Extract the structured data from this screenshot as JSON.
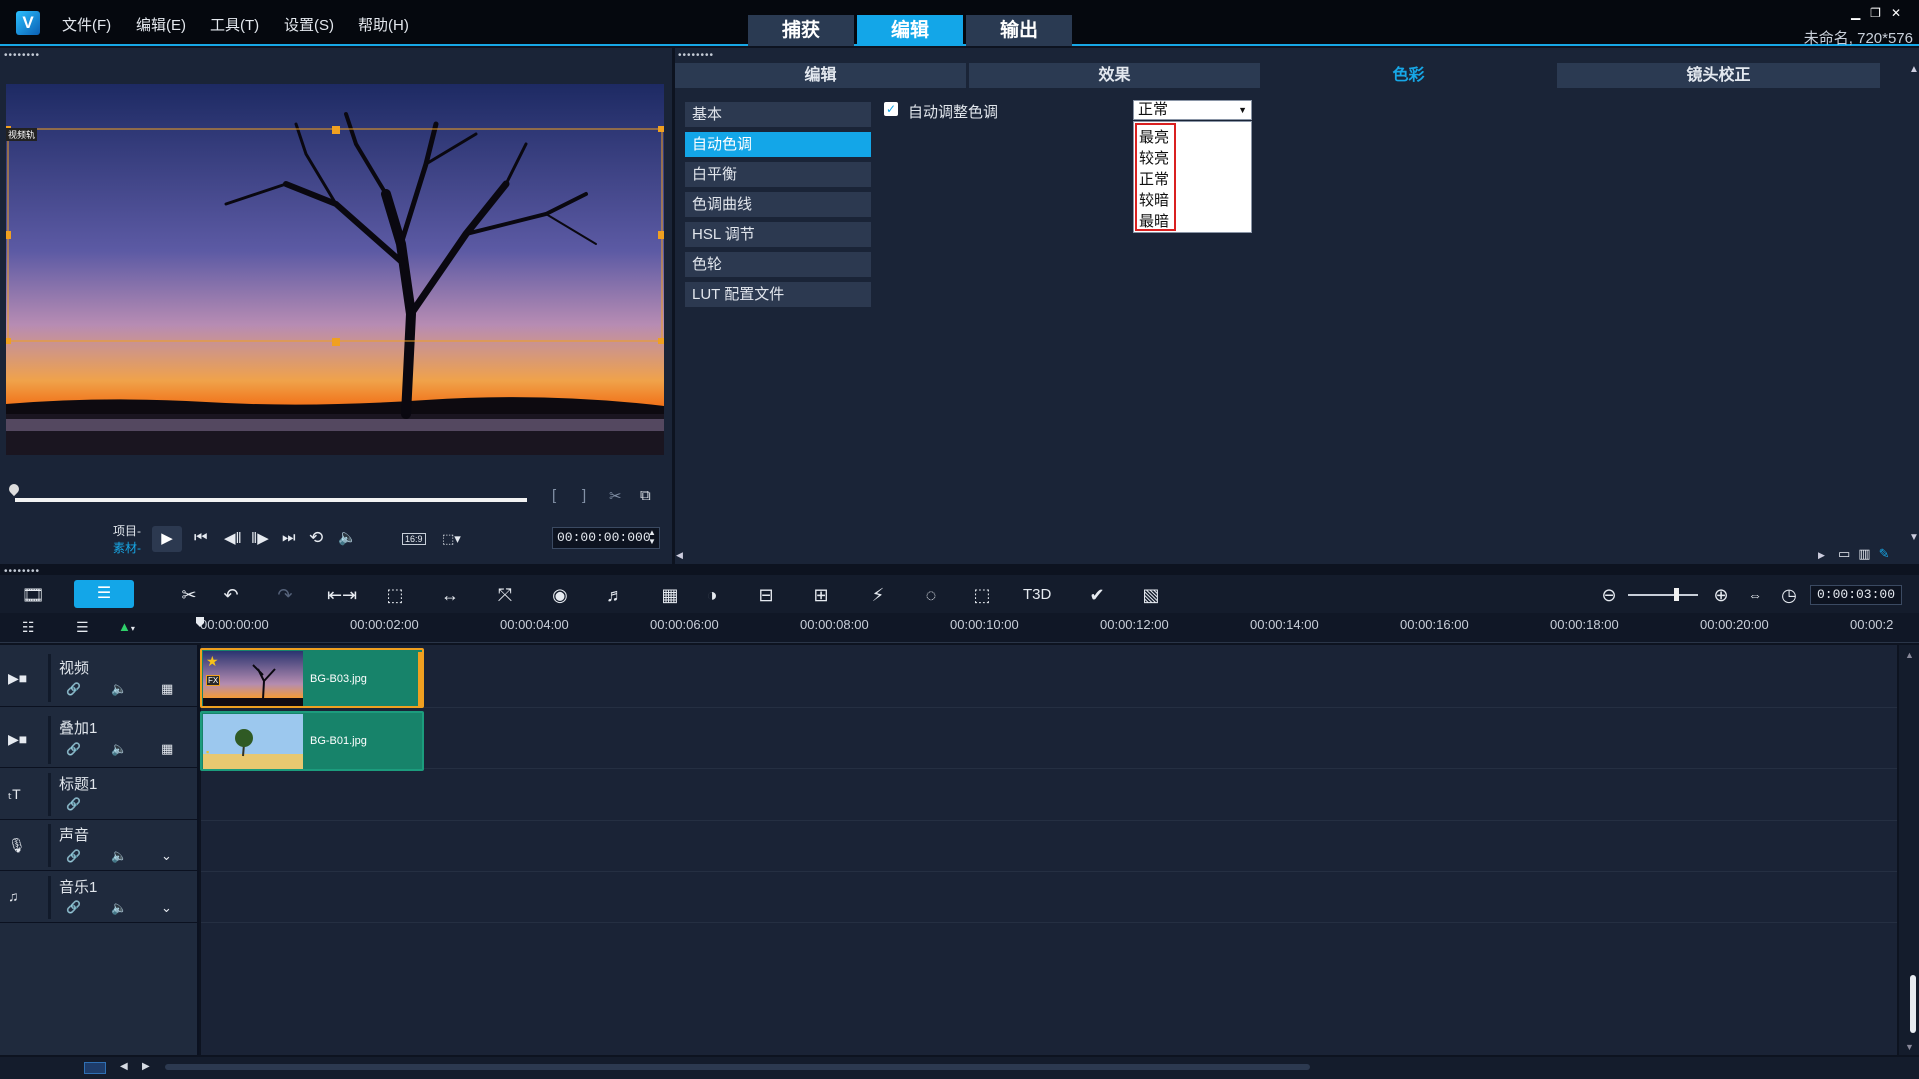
{
  "menu": [
    "文件(F)",
    "编辑(E)",
    "工具(T)",
    "设置(S)",
    "帮助(H)"
  ],
  "modes": [
    "捕获",
    "编辑",
    "输出"
  ],
  "active_mode": 1,
  "project_info": "未命名, 720*576",
  "preview": {
    "overlay_label": "视频轨",
    "mode_labels": [
      "项目-",
      "素材-"
    ],
    "aspect": "16:9",
    "timecode": "00:00:00:000"
  },
  "option_tabs": [
    "编辑",
    "效果",
    "色彩",
    "镜头校正"
  ],
  "active_option_tab": 2,
  "categories": [
    "基本",
    "自动色调",
    "白平衡",
    "色调曲线",
    "HSL 调节",
    "色轮",
    "LUT 配置文件"
  ],
  "active_category": 1,
  "auto_tone": {
    "checkbox_label": "自动调整色调",
    "checked": true,
    "selected": "正常",
    "options": [
      "最亮",
      "较亮",
      "正常",
      "较暗",
      "最暗"
    ]
  },
  "timeline": {
    "duration": "0:00:03:00",
    "ruler_ticks": [
      "00:00:00:00",
      "00:00:02:00",
      "00:00:04:00",
      "00:00:06:00",
      "00:00:08:00",
      "00:00:10:00",
      "00:00:12:00",
      "00:00:14:00",
      "00:00:16:00",
      "00:00:18:00",
      "00:00:20:00",
      "00:00:2"
    ],
    "tracks": [
      "视频",
      "叠加1",
      "标题1",
      "声音",
      "音乐1"
    ],
    "clips": [
      {
        "label": "BG-B03.jpg",
        "badge": "FX"
      },
      {
        "label": "BG-B01.jpg",
        "badge": ""
      }
    ]
  },
  "colors": {
    "accent": "#13a6e8",
    "clip": "#17836a",
    "select_border": "#f0a020",
    "highlight_box": "#d92020"
  }
}
